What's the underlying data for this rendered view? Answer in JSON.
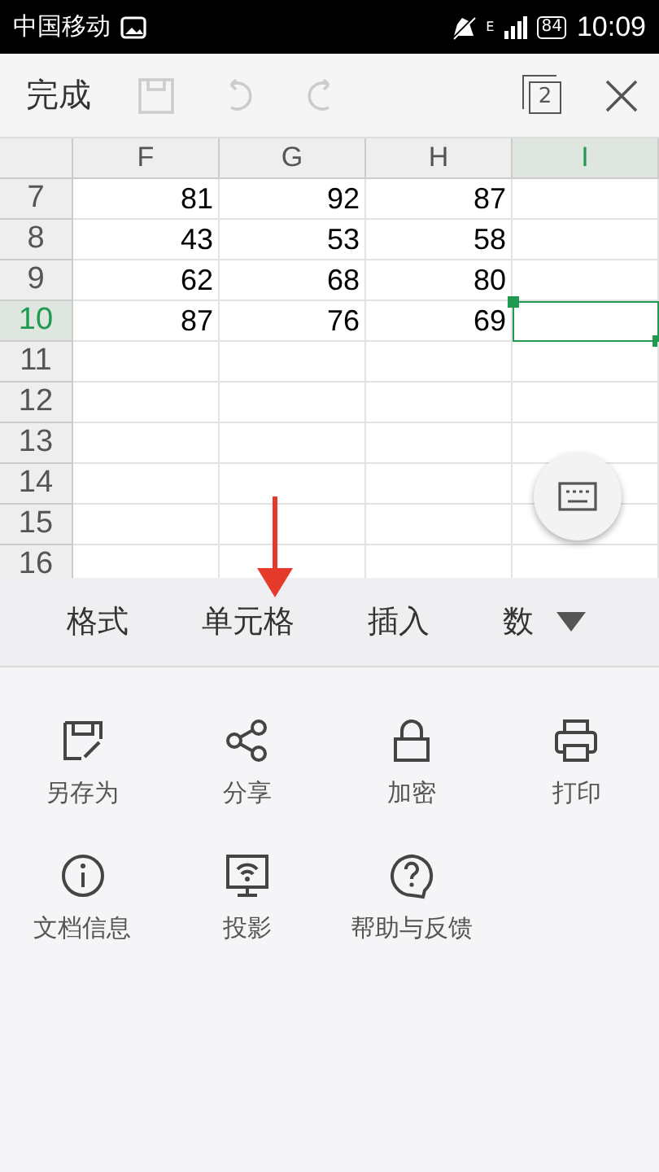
{
  "status_bar": {
    "carrier": "中国移动",
    "network": "E",
    "battery": "84",
    "time": "10:09"
  },
  "toolbar": {
    "done": "完成",
    "tab_count": "2"
  },
  "sheet": {
    "columns": [
      {
        "label": "F",
        "selected": false
      },
      {
        "label": "G",
        "selected": false
      },
      {
        "label": "H",
        "selected": false
      },
      {
        "label": "I",
        "selected": true
      }
    ],
    "rows": [
      {
        "header": "7",
        "selected": false,
        "cells": [
          {
            "text": "81",
            "selected": false
          },
          {
            "text": "92",
            "selected": false
          },
          {
            "text": "87",
            "selected": false
          },
          {
            "text": "",
            "selected": false
          }
        ]
      },
      {
        "header": "8",
        "selected": false,
        "cells": [
          {
            "text": "43",
            "selected": false
          },
          {
            "text": "53",
            "selected": false
          },
          {
            "text": "58",
            "selected": false
          },
          {
            "text": "",
            "selected": false
          }
        ]
      },
      {
        "header": "9",
        "selected": false,
        "cells": [
          {
            "text": "62",
            "selected": false
          },
          {
            "text": "68",
            "selected": false
          },
          {
            "text": "80",
            "selected": false
          },
          {
            "text": "",
            "selected": false
          }
        ]
      },
      {
        "header": "10",
        "selected": true,
        "cells": [
          {
            "text": "87",
            "selected": false
          },
          {
            "text": "76",
            "selected": false
          },
          {
            "text": "69",
            "selected": false
          },
          {
            "text": "",
            "selected": true
          }
        ]
      },
      {
        "header": "11",
        "selected": false,
        "cells": [
          "",
          "",
          "",
          ""
        ]
      },
      {
        "header": "12",
        "selected": false,
        "cells": [
          "",
          "",
          "",
          ""
        ]
      },
      {
        "header": "13",
        "selected": false,
        "cells": [
          "",
          "",
          "",
          ""
        ]
      },
      {
        "header": "14",
        "selected": false,
        "cells": [
          "",
          "",
          "",
          ""
        ]
      },
      {
        "header": "15",
        "selected": false,
        "cells": [
          "",
          "",
          "",
          ""
        ]
      },
      {
        "header": "16",
        "selected": false,
        "cells": [
          "",
          "",
          "",
          ""
        ]
      }
    ]
  },
  "tabs": [
    {
      "label": "格式",
      "selected": false
    },
    {
      "label": "单元格",
      "selected": false
    },
    {
      "label": "插入",
      "selected": false
    },
    {
      "label": "数",
      "selected": false
    }
  ],
  "menu": [
    {
      "label": "另存为",
      "kind": "saveas"
    },
    {
      "label": "分享",
      "kind": "share"
    },
    {
      "label": "加密",
      "kind": "lock"
    },
    {
      "label": "打印",
      "kind": "print"
    },
    {
      "label": "文档信息",
      "kind": "info"
    },
    {
      "label": "投影",
      "kind": "cast"
    },
    {
      "label": "帮助与反馈",
      "kind": "help"
    }
  ]
}
